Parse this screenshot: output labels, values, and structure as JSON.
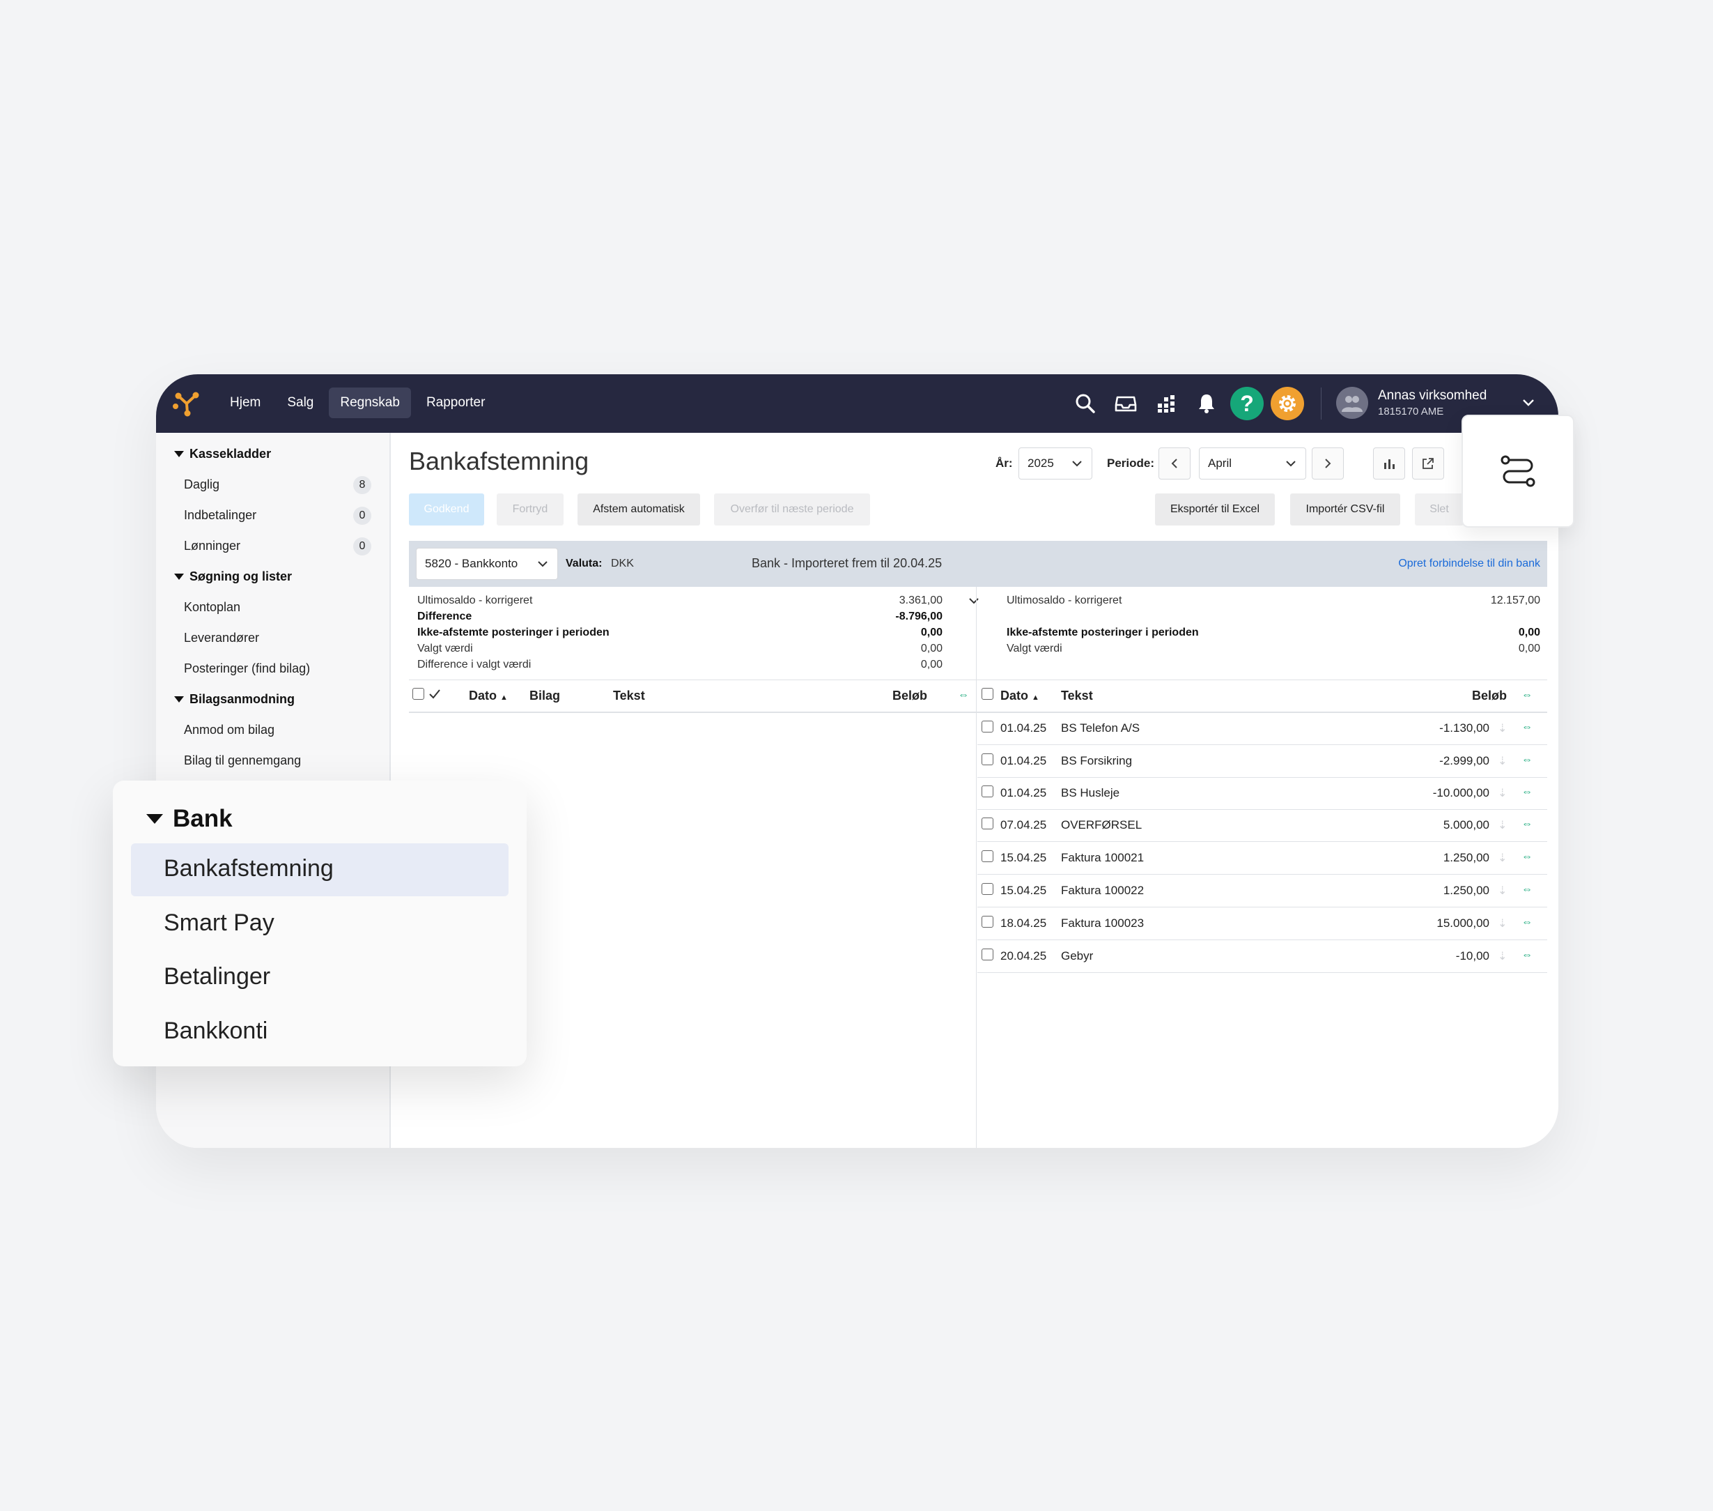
{
  "topbar": {
    "nav": [
      "Hjem",
      "Salg",
      "Regnskab",
      "Rapporter"
    ],
    "help_symbol": "?",
    "user_name": "Annas virksomhed",
    "user_sub": "1815170 AME"
  },
  "sidebar": {
    "groups": [
      {
        "label": "Kassekladder",
        "items": [
          {
            "label": "Daglig",
            "badge": "8"
          },
          {
            "label": "Indbetalinger",
            "badge": "0"
          },
          {
            "label": "Lønninger",
            "badge": "0"
          }
        ]
      },
      {
        "label": "Søgning og lister",
        "items": [
          {
            "label": "Kontoplan"
          },
          {
            "label": "Leverandører"
          },
          {
            "label": "Posteringer (find bilag)"
          }
        ]
      },
      {
        "label": "Bilagsanmodning",
        "items": [
          {
            "label": "Anmod om bilag"
          },
          {
            "label": "Bilag til gennemgang"
          }
        ]
      }
    ]
  },
  "main": {
    "title": "Bankafstemning",
    "year_label": "År:",
    "year_value": "2025",
    "period_label": "Periode:",
    "period_value": "April",
    "buttons": {
      "godkend": "Godkend",
      "fortryd": "Fortryd",
      "afstem": "Afstem automatisk",
      "overfoer": "Overfør til næste periode",
      "eksporter": "Eksportér til Excel",
      "importer": "Importér CSV-fil",
      "slet": "Slet"
    },
    "bankbar": {
      "account": "5820 - Bankkonto",
      "valuta_label": "Valuta:",
      "valuta_value": "DKK",
      "imported": "Bank - Importeret frem til 20.04.25",
      "connect_link": "Opret forbindelse til din bank"
    },
    "left_summary": [
      {
        "label": "Ultimosaldo - korrigeret",
        "value": "3.361,00",
        "bold": false
      },
      {
        "label": "Difference",
        "value": "-8.796,00",
        "bold": true
      },
      {
        "label": "Ikke-afstemte posteringer i perioden",
        "value": "0,00",
        "bold": true
      },
      {
        "label": "Valgt værdi",
        "value": "0,00",
        "bold": false
      },
      {
        "label": "Difference i valgt værdi",
        "value": "0,00",
        "bold": false
      }
    ],
    "right_summary": [
      {
        "label": "Ultimosaldo - korrigeret",
        "value": "12.157,00",
        "bold": false
      },
      {
        "label": "",
        "value": "",
        "bold": false
      },
      {
        "label": "Ikke-afstemte posteringer i perioden",
        "value": "0,00",
        "bold": true
      },
      {
        "label": "Valgt værdi",
        "value": "0,00",
        "bold": false
      }
    ],
    "left_columns": {
      "dato": "Dato",
      "bilag": "Bilag",
      "tekst": "Tekst",
      "beloeb": "Beløb"
    },
    "right_columns": {
      "dato": "Dato",
      "tekst": "Tekst",
      "beloeb": "Beløb"
    },
    "rows": [
      {
        "date": "01.04.25",
        "text": "BS Telefon A/S",
        "amount": "-1.130,00"
      },
      {
        "date": "01.04.25",
        "text": "BS Forsikring",
        "amount": "-2.999,00"
      },
      {
        "date": "01.04.25",
        "text": "BS Husleje",
        "amount": "-10.000,00"
      },
      {
        "date": "07.04.25",
        "text": "OVERFØRSEL",
        "amount": "5.000,00"
      },
      {
        "date": "15.04.25",
        "text": "Faktura 100021",
        "amount": "1.250,00"
      },
      {
        "date": "15.04.25",
        "text": "Faktura 100022",
        "amount": "1.250,00"
      },
      {
        "date": "18.04.25",
        "text": "Faktura 100023",
        "amount": "15.000,00"
      },
      {
        "date": "20.04.25",
        "text": "Gebyr",
        "amount": "-10,00"
      }
    ]
  },
  "bank_menu": {
    "title": "Bank",
    "items": [
      "Bankafstemning",
      "Smart Pay",
      "Betalinger",
      "Bankkonti"
    ],
    "active": "Bankafstemning"
  },
  "colors": {
    "topbar": "#262840",
    "accent_green": "#16a779",
    "accent_orange": "#f0a030",
    "link_blue": "#1a6ad8"
  }
}
